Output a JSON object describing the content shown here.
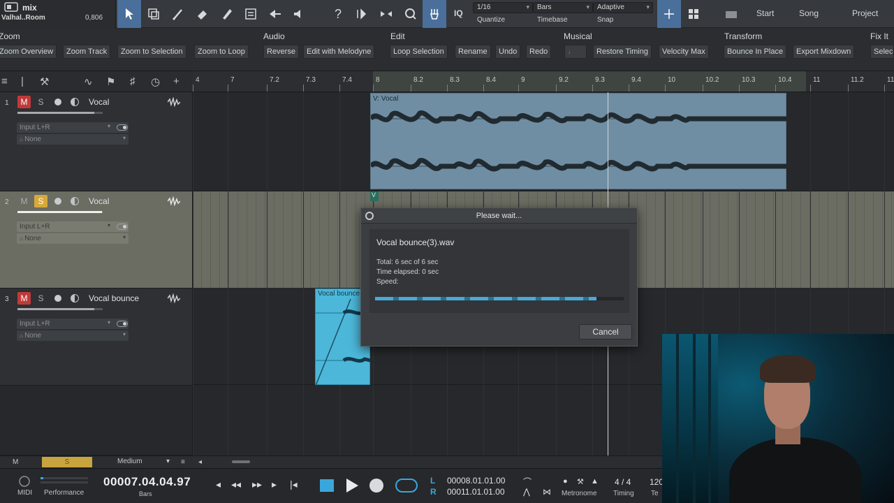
{
  "song": {
    "name": "mix",
    "subtitle": "Valhal..Room",
    "cpu": "0,806"
  },
  "toolbar": {
    "quantize_value": "1/16",
    "quantize_label": "Quantize",
    "timebase_value": "Bars",
    "timebase_label": "Timebase",
    "snap_value": "Adaptive",
    "snap_label": "Snap",
    "iq_label": "IQ",
    "pages": [
      "Start",
      "Song",
      "Project"
    ]
  },
  "function_bar": {
    "groups": [
      "Zoom",
      "Audio",
      "Edit",
      "Musical",
      "Transform",
      "Fix It"
    ],
    "buttons": {
      "zoom_overview": "Zoom Overview",
      "zoom_track": "Zoom Track",
      "zoom_to_selection": "Zoom to Selection",
      "zoom_to_loop": "Zoom to Loop",
      "reverse": "Reverse",
      "edit_melodyne": "Edit with Melodyne",
      "loop_selection": "Loop Selection",
      "rename": "Rename",
      "undo": "Undo",
      "redo": "Redo",
      "restore_timing": "Restore Timing",
      "velocity_max": "Velocity Max",
      "bounce_in_place": "Bounce In Place",
      "export_mixdown": "Export Mixdown",
      "select": "Selec"
    }
  },
  "ruler": {
    "ticks": [
      "4",
      "7",
      "7.2",
      "7.3",
      "7.4",
      "8",
      "8.2",
      "8.3",
      "8.4",
      "9",
      "9.2",
      "9.3",
      "9.4",
      "10",
      "10.2",
      "10.3",
      "10.4",
      "11",
      "11.2",
      "11.3"
    ]
  },
  "tracks": [
    {
      "number": "1",
      "name": "Vocal",
      "mute": "M",
      "solo": "S",
      "input": "Input L+R",
      "output": "None",
      "mute_on": true,
      "solo_on": false,
      "fader_level": 0.9
    },
    {
      "number": "2",
      "name": "Vocal",
      "mute": "M",
      "solo": "S",
      "input": "Input L+R",
      "output": "None",
      "mute_on": false,
      "solo_on": true,
      "fader_level": 0.99
    },
    {
      "number": "3",
      "name": "Vocal bounce",
      "mute": "M",
      "solo": "S",
      "input": "Input L+R",
      "output": "None",
      "mute_on": true,
      "solo_on": false,
      "fader_level": 0.9
    }
  ],
  "events": {
    "vocal_label": "V: Vocal",
    "vocal2_label": "V",
    "bounce_label": "Vocal bounce"
  },
  "dialog": {
    "title": "Please wait...",
    "filename": "Vocal bounce(3).wav",
    "total": "Total: 6 sec of 6 sec",
    "elapsed": "Time elapsed: 0 sec",
    "speed": "Speed:",
    "progress": 0.89,
    "cancel_label": "Cancel"
  },
  "statusrow": {
    "m_label": "M",
    "s_label": "S",
    "zoom_select": "Medium"
  },
  "transport": {
    "midi_label": "MIDI",
    "performance_label": "Performance",
    "time": "00007.04.04.97",
    "time_unit": "Bars",
    "left_key": "L",
    "right_key": "R",
    "left_locator": "00008.01.01.00",
    "right_locator": "00011.01.01.00",
    "metronome_label": "Metronome",
    "signature": "4 / 4",
    "timing_label": "Timing",
    "tempo": "120",
    "tempo_label": "Te"
  },
  "colors": {
    "accent": "#3aa7dc",
    "mute": "#c03a3a",
    "solo": "#d6a93a",
    "event_vocal": "#6f8ea3",
    "event_bounce": "#4cb7d8"
  }
}
